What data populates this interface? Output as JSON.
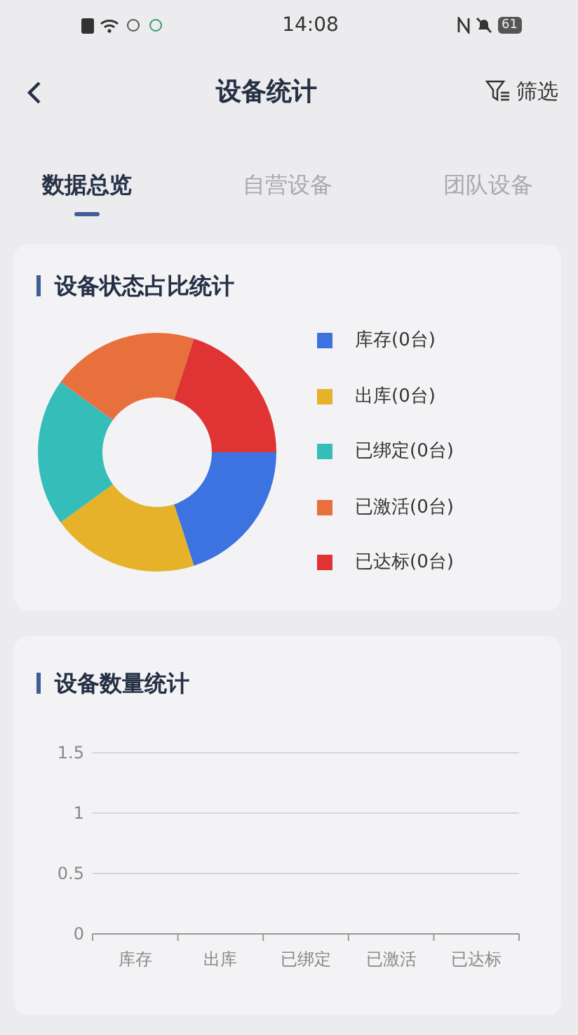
{
  "status_bar": {
    "time": "14:08",
    "battery": "61"
  },
  "header": {
    "title": "设备统计",
    "filter_label": "筛选"
  },
  "tabs": [
    {
      "label": "数据总览",
      "selected": true
    },
    {
      "label": "自营设备",
      "selected": false
    },
    {
      "label": "团队设备",
      "selected": false
    }
  ],
  "status_card": {
    "title": "设备状态占比统计",
    "legend": [
      {
        "color": "#3d73e0"
      },
      {
        "color": "#e6b22a"
      },
      {
        "color": "#35bdb9"
      },
      {
        "color": "#e8703d"
      },
      {
        "color": "#e03333"
      }
    ],
    "chart_data": {
      "type": "donut",
      "categories": [
        "库存(0台)",
        "出库(0台)",
        "已绑定(0台)",
        "已激活(0台)",
        "已达标(0台)"
      ],
      "values": [
        20,
        20,
        20,
        20,
        20
      ]
    }
  },
  "count_card": {
    "title": "设备数量统计",
    "chart_data": {
      "type": "bar",
      "categories": [
        "库存",
        "出库",
        "已绑定",
        "已激活",
        "已达标"
      ],
      "values": [
        0,
        0,
        0,
        0,
        0
      ],
      "ylim": [
        0,
        1.5
      ],
      "yticks": [
        0,
        0.5,
        1,
        1.5
      ]
    }
  }
}
